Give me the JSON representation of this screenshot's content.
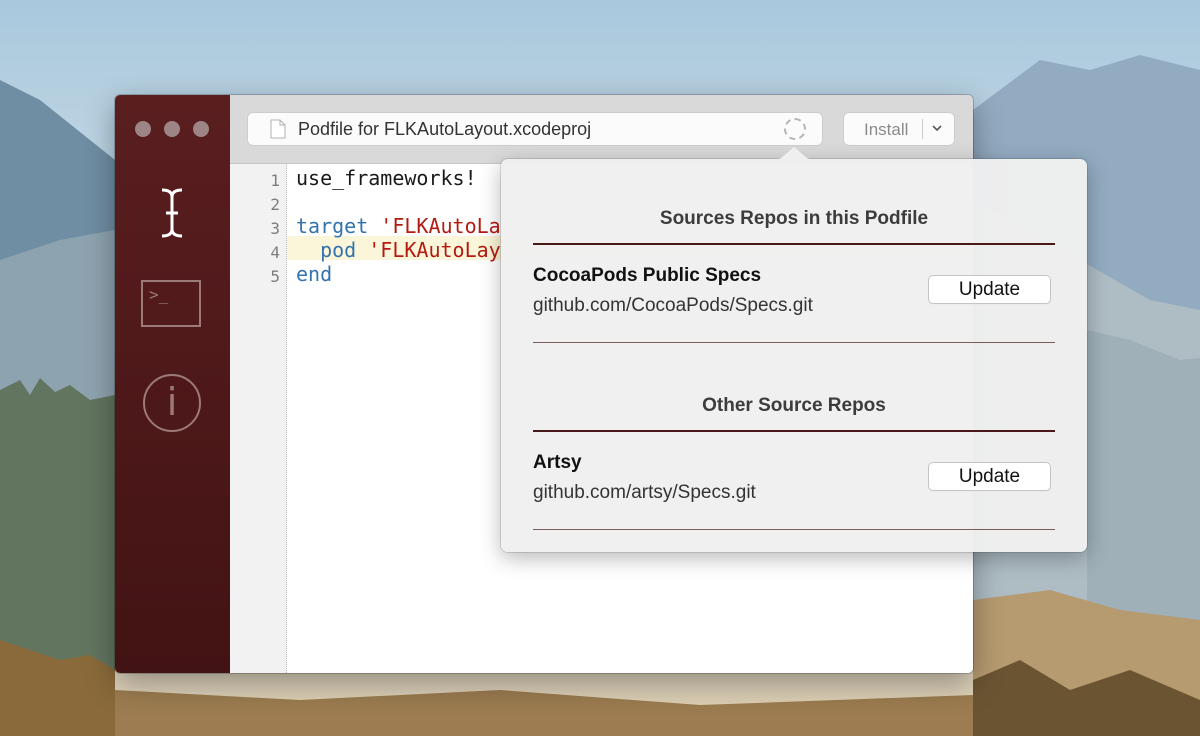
{
  "window": {
    "path_title": "Podfile for FLKAutoLayout.xcodeproj",
    "install_label": "Install"
  },
  "sidebar": {
    "items": [
      {
        "icon": "text-cursor-icon"
      },
      {
        "icon": "terminal-icon",
        "glyph": ">_"
      },
      {
        "icon": "info-icon",
        "glyph": "i"
      }
    ]
  },
  "editor": {
    "line_numbers": [
      "1",
      "2",
      "3",
      "4",
      "5"
    ],
    "lines": {
      "l1": "use_frameworks!",
      "l3_kw": "target",
      "l3_str": "'FLKAutoLa",
      "l4_kw": "  pod",
      "l4_str": "'FLKAutoLay",
      "l5_kw": "end"
    },
    "highlighted_line": 4
  },
  "popover": {
    "sources_title": "Sources Repos in this Podfile",
    "other_title": "Other Source Repos",
    "repos": [
      {
        "name": "CocoaPods Public Specs",
        "url": "github.com/CocoaPods/Specs.git",
        "button": "Update"
      },
      {
        "name": "Artsy",
        "url": "github.com/artsy/Specs.git",
        "button": "Update"
      }
    ]
  },
  "colors": {
    "sidebar": "#4f1a1b",
    "keyword": "#3473ad",
    "string": "#b31b12",
    "rule": "#4a1818"
  }
}
